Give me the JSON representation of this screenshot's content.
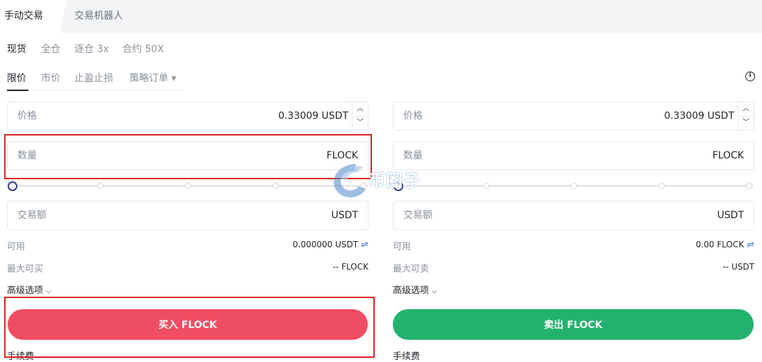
{
  "tabs": {
    "manual": "手动交易",
    "bot": "交易机器人"
  },
  "modes": [
    "现货",
    "全仓",
    "逐仓 3x",
    "合约 50X"
  ],
  "order_types": [
    "限价",
    "市价",
    "止盈止损",
    "策略订单 ▾"
  ],
  "buy": {
    "price_label": "价格",
    "price_value": "0.33009 USDT",
    "qty_label": "数量",
    "qty_unit": "FLOCK",
    "amount_label": "交易额",
    "amount_unit": "USDT",
    "available_label": "可用",
    "available_value": "0.000000 USDT",
    "max_label": "最大可买",
    "max_value": "-- FLOCK",
    "advanced_label": "高级选项",
    "button_label": "买入 FLOCK",
    "fee_label": "手续费"
  },
  "sell": {
    "price_label": "价格",
    "price_value": "0.33009 USDT",
    "qty_label": "数量",
    "qty_unit": "FLOCK",
    "amount_label": "交易额",
    "amount_unit": "USDT",
    "available_label": "可用",
    "available_value": "0.00 FLOCK",
    "max_label": "最大可卖",
    "max_value": "-- USDT",
    "advanced_label": "高级选项",
    "button_label": "卖出 FLOCK",
    "fee_label": "手续费"
  },
  "watermark": "币圈子",
  "colors": {
    "buy": "#f04d62",
    "sell": "#23b26d",
    "annotation": "#d9231f",
    "accent": "#3b6be0"
  },
  "slider": {
    "buy_percent": 0,
    "sell_percent": 0
  }
}
